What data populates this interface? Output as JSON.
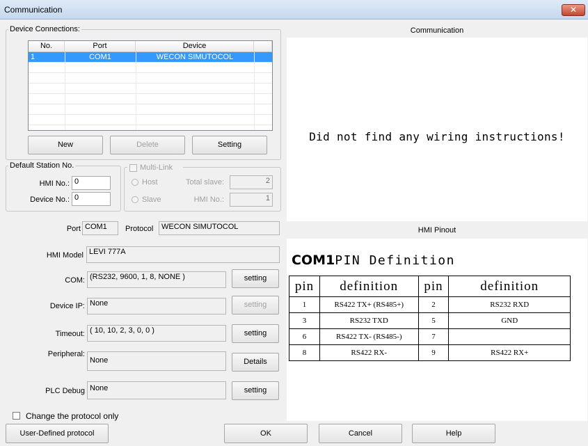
{
  "window": {
    "title": "Communication",
    "close_glyph": "✕"
  },
  "device_connections": {
    "group_label": "Device Connections:",
    "columns": [
      "No.",
      "Port",
      "Device"
    ],
    "rows": [
      {
        "no": "1",
        "port": "COM1",
        "device": "WECON SIMUTOCOL"
      }
    ],
    "new_label": "New",
    "delete_label": "Delete",
    "setting_label": "Setting"
  },
  "default_station": {
    "group_label": "Default Station No.",
    "hmi_no_label": "HMI No.:",
    "hmi_no_value": "0",
    "device_no_label": "Device No.:",
    "device_no_value": "0"
  },
  "multilink": {
    "label": "Multi-Link",
    "host_label": "Host",
    "slave_label": "Slave",
    "total_slave_label": "Total slave:",
    "total_slave_value": "2",
    "hmi_no_label": "HMI No.:",
    "hmi_no_value": "1"
  },
  "settings": {
    "port_label": "Port",
    "port_value": "COM1",
    "protocol_label": "Protocol",
    "protocol_value": "WECON SIMUTOCOL",
    "hmi_model_label": "HMI Model",
    "hmi_model_value": "LEVI 777A",
    "com_label": "COM:",
    "com_value": "(RS232, 9600, 1, 8, NONE )",
    "com_button": "setting",
    "device_ip_label": "Device IP:",
    "device_ip_value": "None",
    "device_ip_button": "setting",
    "timeout_label": "Timeout:",
    "timeout_value": "( 10, 10, 2, 3, 0, 0 )",
    "timeout_button": "setting",
    "peripheral_label": "Peripheral:",
    "peripheral_value": "None",
    "peripheral_button": "Details",
    "plc_debug_label": "PLC Debug",
    "plc_debug_value": "None",
    "plc_debug_button": "setting"
  },
  "change_protocol_label": "Change the protocol only",
  "communication_panel": {
    "title": "Communication",
    "message": "Did not find any wiring instructions!"
  },
  "hmi_pinout": {
    "title": "HMI Pinout",
    "heading_port": "COM1",
    "heading_rest": "PIN Definition",
    "header": [
      "pin",
      "definition",
      "pin",
      "definition"
    ],
    "rows": [
      [
        "1",
        "RS422 TX+ (RS485+)",
        "2",
        "RS232 RXD"
      ],
      [
        "3",
        "RS232 TXD",
        "5",
        "GND"
      ],
      [
        "6",
        "RS422 TX- (RS485-)",
        "7",
        ""
      ],
      [
        "8",
        "RS422 RX-",
        "9",
        "RS422 RX+"
      ]
    ]
  },
  "footer": {
    "user_defined_label": "User-Defined protocol",
    "ok_label": "OK",
    "cancel_label": "Cancel",
    "help_label": "Help"
  }
}
